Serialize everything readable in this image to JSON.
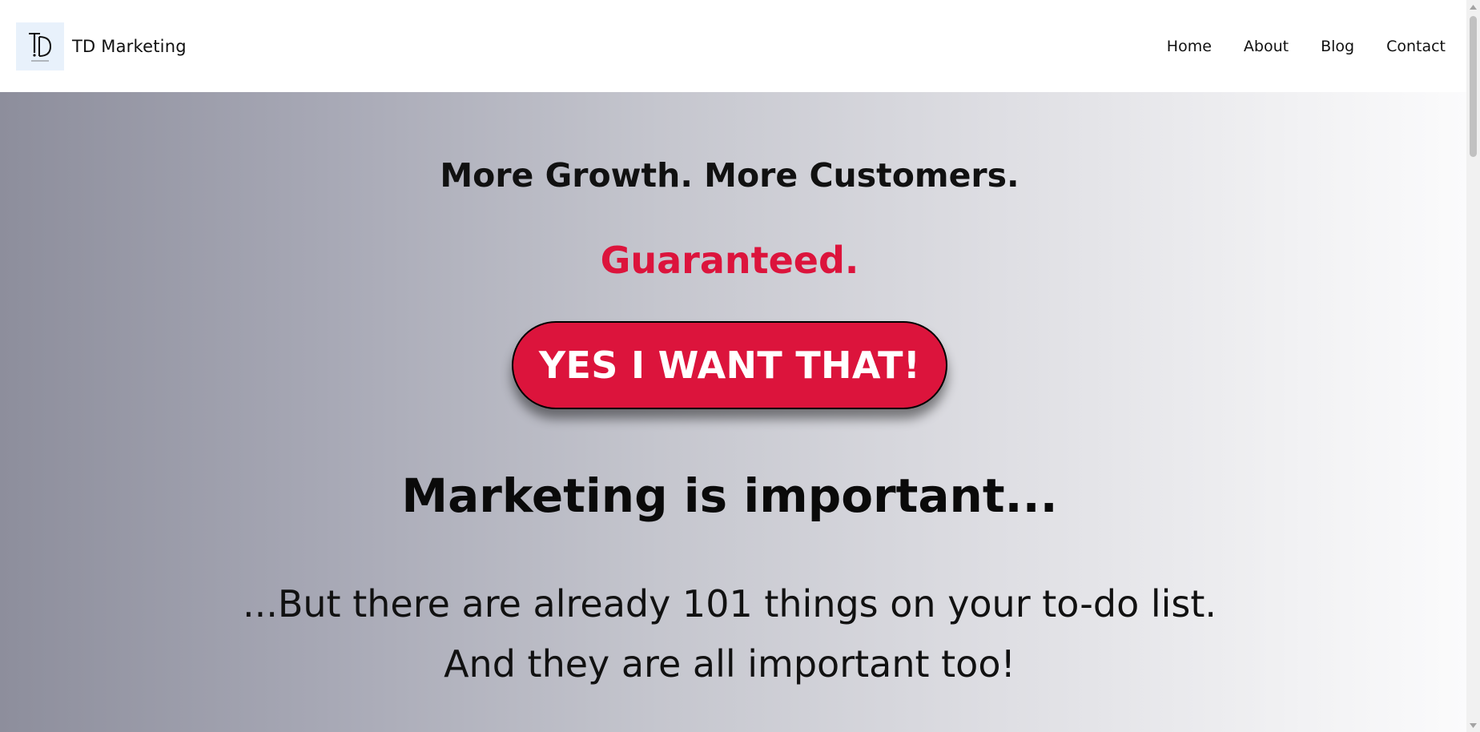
{
  "header": {
    "brand_name": "TD Marketing",
    "logo_letters": "TD",
    "nav": [
      {
        "label": "Home"
      },
      {
        "label": "About"
      },
      {
        "label": "Blog"
      },
      {
        "label": "Contact"
      }
    ]
  },
  "hero": {
    "headline": "More Growth. More Customers.",
    "guarantee": "Guaranteed.",
    "cta_label": "YES I WANT THAT!",
    "section_title": "Marketing is important...",
    "body_lines": [
      "...But there are already 101 things on your to-do list.",
      "And they are all important too!"
    ]
  },
  "colors": {
    "accent": "#dc143c",
    "text": "#111111",
    "logo_bg": "#e8f1fb"
  },
  "icons": {
    "scroll_up": "triangle-up-icon",
    "scroll_down": "triangle-down-icon"
  }
}
